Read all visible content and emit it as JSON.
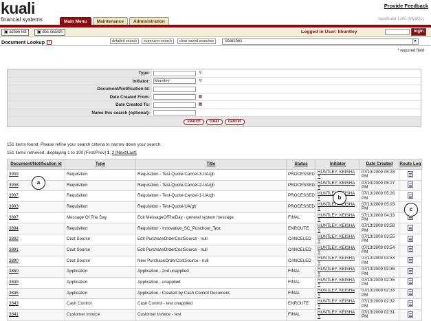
{
  "header": {
    "logo_main": "kuali",
    "logo_sub": "financial systems",
    "provide_feedback": "Provide Feedback",
    "env_label": "teps/build-1205 (MySQL)",
    "tabs": [
      {
        "label": "Main Menu"
      },
      {
        "label": "Maintenance"
      },
      {
        "label": "Administration"
      }
    ]
  },
  "toolbar": {
    "action_list": "action list",
    "doc_search": "doc search",
    "logged_in": "Logged in User: khuntley",
    "login_button": "login"
  },
  "titlebar": {
    "title": "Document Lookup",
    "help": "?",
    "detailed_search": "detailed search",
    "superuser_search": "superuser search",
    "clear_saved": "clear saved searches",
    "searches_select": "Searches"
  },
  "required_note": "* required field",
  "form": {
    "fields": [
      {
        "label": "Type:",
        "value": ""
      },
      {
        "label": "Initiator:",
        "value": "khuntley"
      },
      {
        "label": "Document/Notification Id:",
        "value": ""
      },
      {
        "label": "Date Created From:",
        "value": ""
      },
      {
        "label": "Date Created To:",
        "value": ""
      },
      {
        "label": "Name this search (optional):",
        "value": ""
      }
    ],
    "buttons": {
      "search": "search",
      "clear": "clear",
      "cancel": "cancel"
    }
  },
  "messages": {
    "found": "151 items found. Please refine your search criteria to narrow down your search.",
    "retrieved_prefix": "151 items retrieved, displaying 1 to 100.[First/Prev] ",
    "page1": "1",
    "page_sep": ", ",
    "page2": "2",
    "next_last": " [Next/Last]"
  },
  "table": {
    "headers": {
      "doc_id": "Document/Notification Id",
      "type": "Type",
      "title": "Title",
      "status": "Status",
      "initiator": "Initiator",
      "date_created": "Date Created",
      "route_log": "Route Log"
    },
    "rows": [
      {
        "id": "3909",
        "type": "Requisition",
        "title": "Requisition - Test-Quote-Cancel-3-UA/gh",
        "status": "PROCESSED",
        "initiator": "HUNTLEY, KEISHA Y",
        "date": "07/13/2009 05:28 PM"
      },
      {
        "id": "3908",
        "type": "Requisition",
        "title": "Requisition - Test-Quote-Cancel-2-UA/gh",
        "status": "PROCESSED",
        "initiator": "HUNTLEY, KEISHA Y",
        "date": "07/13/2009 05:27 PM"
      },
      {
        "id": "3907",
        "type": "Requisition",
        "title": "Requisition - Test-Quote-Cancel-1-UA/gh",
        "status": "PROCESSED",
        "initiator": "HUNTLEY, KEISHA Y",
        "date": "07/13/2009 05:26 PM"
      },
      {
        "id": "3903",
        "type": "Requisition",
        "title": "Requisition - Test-Quote-UA/gh",
        "status": "PROCESSED",
        "initiator": "HUNTLEY, KEISHA Y",
        "date": "07/13/2009 05:03 PM"
      },
      {
        "id": "3897",
        "type": "Message Of The Day",
        "title": "Edit MessageOfTheDay - general system message",
        "status": "FINAL",
        "initiator": "HUNTLEY, KEISHA Y",
        "date": "07/13/2009 04:33 PM"
      },
      {
        "id": "3894",
        "type": "Requisition",
        "title": "Requisition - Innovative_SC_Punchout_Test",
        "status": "ENROUTE",
        "initiator": "HUNTLEY, KEISHA Y",
        "date": "07/13/2009 03:58 PM"
      },
      {
        "id": "3892",
        "type": "Cost Source",
        "title": "Edit PurchaseOrderCostSource - null",
        "status": "CANCELED",
        "initiator": "HUNTLEY, KEISHA Y",
        "date": "07/13/2009 03:55 PM"
      },
      {
        "id": "3891",
        "type": "Cost Source",
        "title": "Edit PurchaseOrderCostSource - null",
        "status": "CANCELED",
        "initiator": "HUNTLEY, KEISHA Y",
        "date": "07/13/2009 03:54 PM"
      },
      {
        "id": "3890",
        "type": "Cost Source",
        "title": "New PurchaseOrderCostSource - null",
        "status": "CANCELED",
        "initiator": "HUNTLEY, KEISHA Y",
        "date": "07/13/2009 03:53 PM"
      },
      {
        "id": "3850",
        "type": "Application",
        "title": "Application - 2nd unapplied",
        "status": "FINAL",
        "initiator": "HUNTLEY, KEISHA Y",
        "date": "07/13/2009 02:36 PM"
      },
      {
        "id": "3849",
        "type": "Application",
        "title": "Application - unapplied",
        "status": "FINAL",
        "initiator": "HUNTLEY, KEISHA Y",
        "date": "07/13/2009 02:35 PM"
      },
      {
        "id": "3845",
        "type": "Application",
        "title": "Application - Created by Cash Control Document.",
        "status": "FINAL",
        "initiator": "HUNTLEY, KEISHA Y",
        "date": "07/13/2009 02:33 PM"
      },
      {
        "id": "3843",
        "type": "Cash Control",
        "title": "Cash Control - test unapplied",
        "status": "ENROUTE",
        "initiator": "HUNTLEY, KEISHA Y",
        "date": "07/13/2009 02:32 PM"
      },
      {
        "id": "3841",
        "type": "Customer Invoice",
        "title": "Customer Invoice - test",
        "status": "FINAL",
        "initiator": "HUNTLEY, KEISHA Y",
        "date": "07/13/2009 02:31 PM"
      }
    ]
  },
  "callouts": {
    "a": "a",
    "b": "b",
    "c": "c"
  }
}
